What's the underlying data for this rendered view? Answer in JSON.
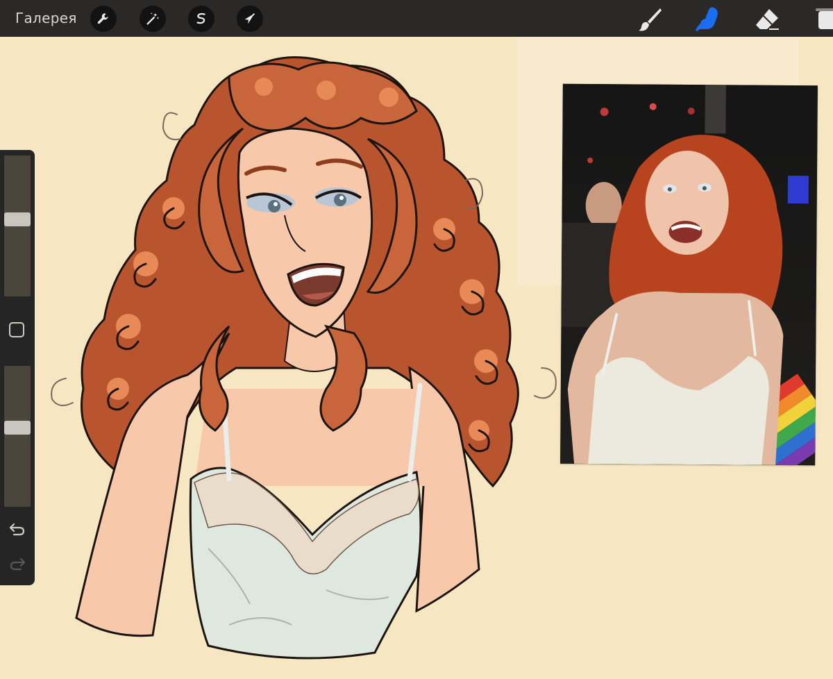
{
  "topbar": {
    "gallery_label": "Галерея",
    "left_tools": [
      {
        "name": "actions",
        "icon": "wrench-icon"
      },
      {
        "name": "adjustments",
        "icon": "magic-wand-icon"
      },
      {
        "name": "selection",
        "icon": "selection-s-icon"
      },
      {
        "name": "transform",
        "icon": "arrow-cursor-icon"
      }
    ],
    "right_tools": [
      {
        "name": "brush",
        "icon": "brush-icon",
        "active": false
      },
      {
        "name": "smudge",
        "icon": "smudge-finger-icon",
        "active": true
      },
      {
        "name": "eraser",
        "icon": "eraser-icon",
        "active": false
      },
      {
        "name": "layers",
        "icon": "layers-icon",
        "active": false
      }
    ]
  },
  "sidebar": {
    "brush_size_level": 0.55,
    "opacity_level": 0.57,
    "undo_icon": "undo-arrow-icon",
    "redo_icon": "redo-arrow-icon"
  },
  "colors": {
    "topbar_bg": "#2a2927",
    "canvas_bg": "#f6e6c1",
    "active_tool": "#1a6cf0",
    "hair": "#b9552e",
    "skin": "#f7c8a9",
    "dress": "#dfe8de"
  }
}
